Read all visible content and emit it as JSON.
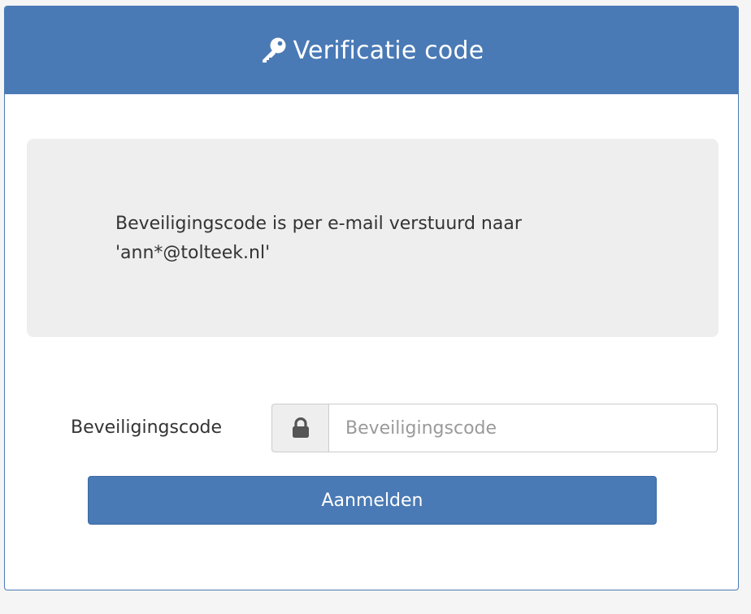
{
  "header": {
    "title": "Verificatie code",
    "icon": "key-icon"
  },
  "info": {
    "line1": "Beveiligingscode is per e-mail verstuurd naar",
    "line2": "'ann*@tolteek.nl'"
  },
  "form": {
    "label": "Beveiligingscode",
    "input_icon": "lock-icon",
    "input_value": "",
    "input_placeholder": "Beveiligingscode",
    "submit_label": "Aanmelden"
  },
  "colors": {
    "primary": "#4a7ab5",
    "info_background": "#eeeeee"
  }
}
